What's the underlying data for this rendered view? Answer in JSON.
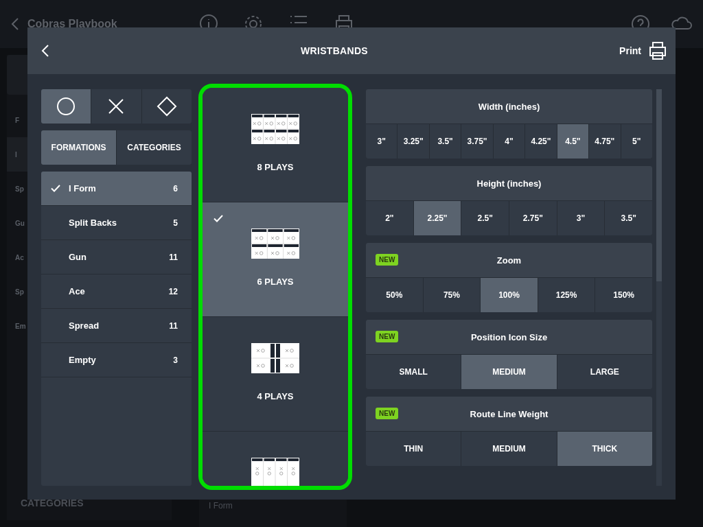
{
  "background": {
    "title": "Cobras Playbook",
    "sidebar_items": [
      {
        "label": "F",
        "selected": false
      },
      {
        "label": "I",
        "selected": true
      },
      {
        "label": "Sp",
        "selected": false
      },
      {
        "label": "Gu",
        "selected": false
      },
      {
        "label": "Ac",
        "selected": false
      },
      {
        "label": "Sp",
        "selected": false
      },
      {
        "label": "Em",
        "selected": false
      }
    ],
    "sidebar_footer": "CATEGORIES",
    "card_label": "I Form"
  },
  "dialog": {
    "title": "WRISTBANDS",
    "print_label": "Print"
  },
  "shape_tabs": [
    {
      "kind": "circle",
      "selected": true
    },
    {
      "kind": "cross",
      "selected": false
    },
    {
      "kind": "diamond",
      "selected": false
    }
  ],
  "list_tabs": [
    {
      "label": "FORMATIONS",
      "selected": true
    },
    {
      "label": "CATEGORIES",
      "selected": false
    }
  ],
  "formations": [
    {
      "name": "I Form",
      "count": "6",
      "selected": true
    },
    {
      "name": "Split Backs",
      "count": "5",
      "selected": false
    },
    {
      "name": "Gun",
      "count": "11",
      "selected": false
    },
    {
      "name": "Ace",
      "count": "12",
      "selected": false
    },
    {
      "name": "Spread",
      "count": "11",
      "selected": false
    },
    {
      "name": "Empty",
      "count": "3",
      "selected": false
    }
  ],
  "layouts": [
    {
      "kind": "grid8",
      "label": "8 PLAYS",
      "selected": false
    },
    {
      "kind": "grid6",
      "label": "6 PLAYS",
      "selected": true
    },
    {
      "kind": "grid4",
      "label": "4 PLAYS",
      "selected": false
    },
    {
      "kind": "columns4",
      "selected": false
    }
  ],
  "settings": [
    {
      "title": "Width (inches)",
      "new": false,
      "options": [
        {
          "label": "3\"",
          "selected": false
        },
        {
          "label": "3.25\"",
          "selected": false
        },
        {
          "label": "3.5\"",
          "selected": false
        },
        {
          "label": "3.75\"",
          "selected": false
        },
        {
          "label": "4\"",
          "selected": false
        },
        {
          "label": "4.25\"",
          "selected": false
        },
        {
          "label": "4.5\"",
          "selected": true
        },
        {
          "label": "4.75\"",
          "selected": false
        },
        {
          "label": "5\"",
          "selected": false
        }
      ]
    },
    {
      "title": "Height (inches)",
      "new": false,
      "options": [
        {
          "label": "2\"",
          "selected": false
        },
        {
          "label": "2.25\"",
          "selected": true
        },
        {
          "label": "2.5\"",
          "selected": false
        },
        {
          "label": "2.75\"",
          "selected": false
        },
        {
          "label": "3\"",
          "selected": false
        },
        {
          "label": "3.5\"",
          "selected": false
        }
      ]
    },
    {
      "title": "Zoom",
      "new": true,
      "badge": "NEW",
      "options": [
        {
          "label": "50%",
          "selected": false
        },
        {
          "label": "75%",
          "selected": false
        },
        {
          "label": "100%",
          "selected": true
        },
        {
          "label": "125%",
          "selected": false
        },
        {
          "label": "150%",
          "selected": false
        }
      ]
    },
    {
      "title": "Position Icon Size",
      "new": true,
      "badge": "NEW",
      "options": [
        {
          "label": "SMALL",
          "selected": false
        },
        {
          "label": "MEDIUM",
          "selected": true
        },
        {
          "label": "LARGE",
          "selected": false
        }
      ]
    },
    {
      "title": "Route Line Weight",
      "new": true,
      "badge": "NEW",
      "options": [
        {
          "label": "THIN",
          "selected": false
        },
        {
          "label": "MEDIUM",
          "selected": false
        },
        {
          "label": "THICK",
          "selected": true
        }
      ]
    }
  ]
}
